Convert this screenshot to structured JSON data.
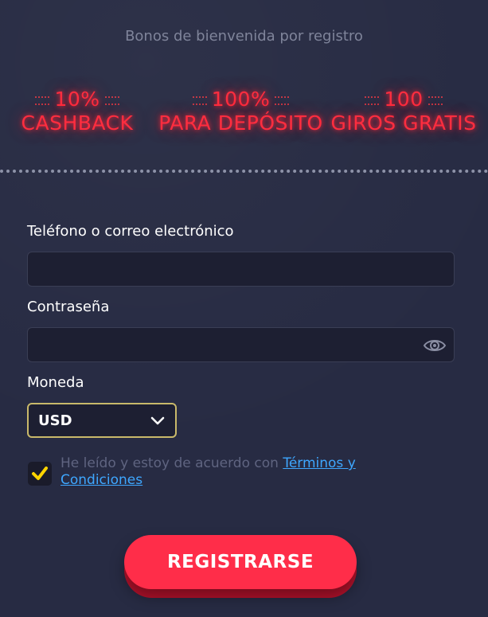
{
  "hero": {
    "title": "Bonos de bienvenida por registro",
    "bonuses": [
      {
        "top": "10%",
        "bottom": "CASHBACK"
      },
      {
        "top": "100%",
        "bottom": "PARA DEPÓSITO"
      },
      {
        "top": "100",
        "bottom": "GIROS GRATIS"
      }
    ],
    "neon_color": "#ff2d3f"
  },
  "form": {
    "phone_label": "Teléfono o correo electrónico",
    "phone_value": "",
    "password_label": "Contraseña",
    "password_value": "",
    "currency_label": "Moneda",
    "currency_value": "USD",
    "terms_prefix": "He leído y estoy de acuerdo con ",
    "terms_link": "Términos y Condiciones",
    "terms_checked": true,
    "submit_label": "REGISTRARSE"
  },
  "colors": {
    "background": "#272b43",
    "accent": "#ff2d49",
    "check": "#ffd400",
    "link": "#3ea7ff"
  },
  "icons": {
    "password_toggle": "eye-icon",
    "currency_dropdown": "chevron-down-icon",
    "terms_check": "checkmark-icon"
  }
}
